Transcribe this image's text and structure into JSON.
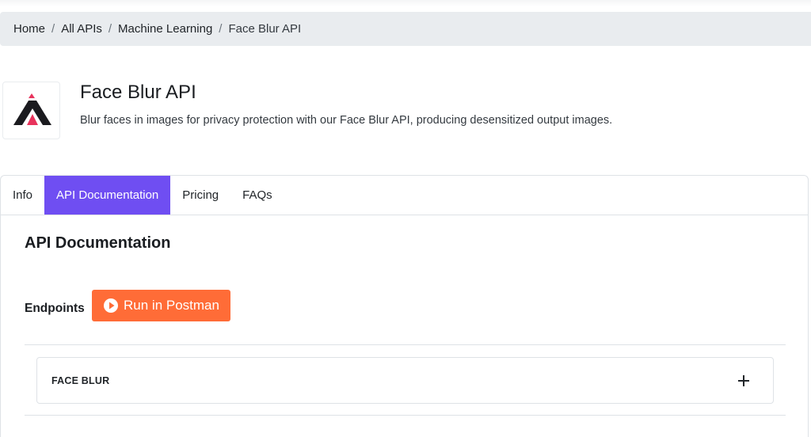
{
  "breadcrumb": {
    "items": [
      "Home",
      "All APIs",
      "Machine Learning",
      "Face Blur API"
    ],
    "separator": "/"
  },
  "header": {
    "title": "Face Blur API",
    "description": "Blur faces in images for privacy protection with our Face Blur API, producing desensitized output images.",
    "logo_icon": "brand-logo-icon"
  },
  "tabs": [
    {
      "label": "Info",
      "active": false
    },
    {
      "label": "API Documentation",
      "active": true
    },
    {
      "label": "Pricing",
      "active": false
    },
    {
      "label": "FAQs",
      "active": false
    }
  ],
  "docs": {
    "section_title": "API Documentation",
    "endpoints_label": "Endpoints",
    "postman_button": "Run in Postman",
    "endpoint_groups": [
      {
        "label": "FACE BLUR",
        "expanded": false
      }
    ]
  },
  "colors": {
    "accent": "#6f4ef2",
    "postman": "#ff6c37",
    "breadcrumb_bg": "#e9ecef",
    "logo_pink": "#e8335c"
  }
}
